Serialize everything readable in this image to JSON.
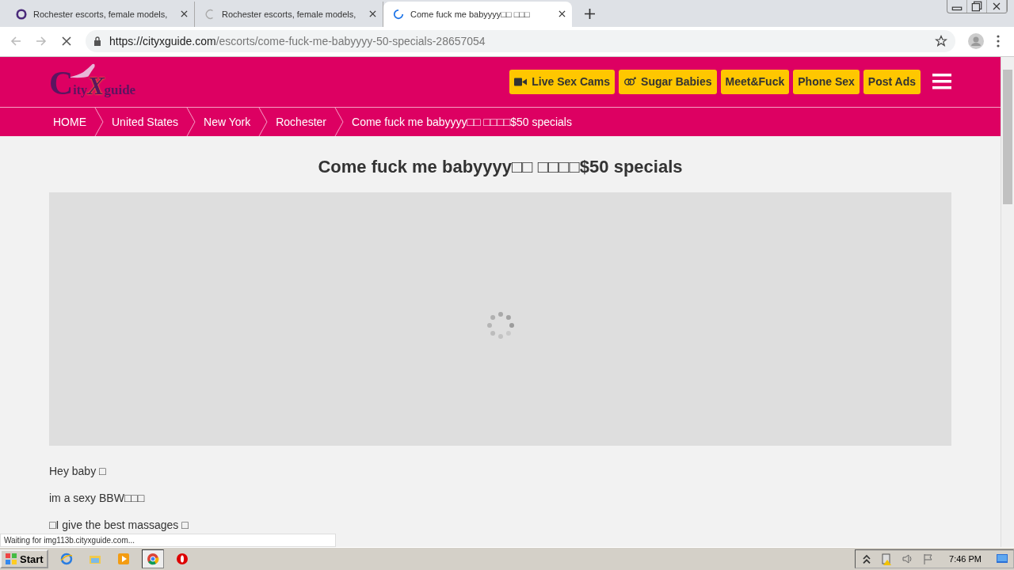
{
  "browser": {
    "tabs": [
      {
        "title": "Rochester escorts, female models,",
        "selected": false,
        "kind": "logo"
      },
      {
        "title": "Rochester escorts, female models,",
        "selected": false,
        "kind": "loading"
      },
      {
        "title": "Come fuck me babyyyy□□ □□□",
        "selected": true,
        "kind": "spinner"
      }
    ],
    "url": {
      "host": "https://cityxguide.com",
      "path": "/escorts/come-fuck-me-babyyyy-50-specials-28657054"
    }
  },
  "site": {
    "logo": [
      "C",
      "ity",
      "X",
      "guide"
    ],
    "nav_buttons": [
      {
        "label": "Live Sex Cams",
        "kind": "camera"
      },
      {
        "label": "Sugar Babies",
        "kind": "gender"
      },
      {
        "label": "Meet&Fuck",
        "kind": "plain"
      },
      {
        "label": "Phone Sex",
        "kind": "plain"
      },
      {
        "label": "Post Ads",
        "kind": "plain"
      }
    ],
    "breadcrumb": [
      "HOME",
      "United States",
      "New York",
      "Rochester",
      "Come fuck me babyyyy□□ □□□□$50 specials"
    ],
    "title": "Come fuck me babyyyy□□ □□□□$50 specials",
    "paragraphs": [
      "Hey baby □",
      "im a sexy BBW□□□",
      "□I give the best massages □"
    ]
  },
  "status_bar": "Waiting for img113b.cityxguide.com...",
  "taskbar": {
    "start": "Start",
    "apps": [
      {
        "kind": "ie",
        "selected": false
      },
      {
        "kind": "folder",
        "selected": false
      },
      {
        "kind": "media",
        "selected": false
      },
      {
        "kind": "chrome",
        "selected": true
      },
      {
        "kind": "opera",
        "selected": false
      }
    ],
    "clock": "7:46 PM"
  }
}
